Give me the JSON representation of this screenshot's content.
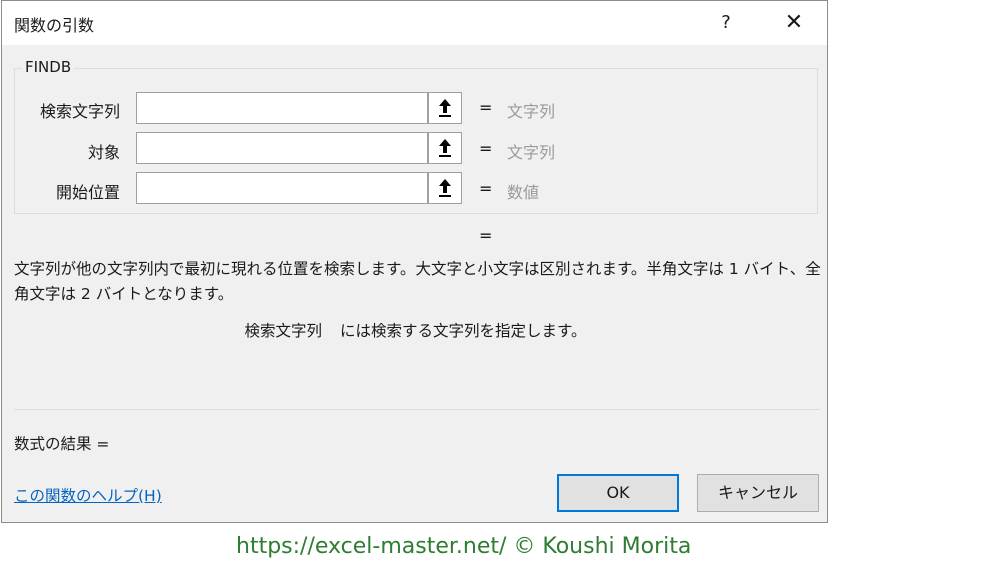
{
  "dialog": {
    "title": "関数の引数",
    "help_button": "?",
    "close_button": "✕"
  },
  "function": {
    "name": "FINDB",
    "arguments": [
      {
        "label": "検索文字列",
        "value": "",
        "type_hint": "文字列"
      },
      {
        "label": "対象",
        "value": "",
        "type_hint": "文字列"
      },
      {
        "label": "開始位置",
        "value": "",
        "type_hint": "数値"
      }
    ],
    "equals": "=",
    "result_preview": "="
  },
  "description": {
    "main": "文字列が他の文字列内で最初に現れる位置を検索します。大文字と小文字は区別されます。半角文字は 1 バイト、全角文字は 2 バイトとなります。",
    "arg_name": "検索文字列",
    "arg_text": "には検索する文字列を指定します。"
  },
  "footer": {
    "formula_result": "数式の結果 =",
    "help_link": "この関数のヘルプ(H)",
    "ok_label": "OK",
    "cancel_label": "キャンセル"
  },
  "watermark": "https://excel-master.net/  © Koushi Morita",
  "icons": {
    "reference": "collapse-dialog-icon"
  },
  "colors": {
    "dialog_bg": "#f0f0f0",
    "link": "#0563c1",
    "ok_border": "#0078d7",
    "watermark": "#2e7d32"
  }
}
